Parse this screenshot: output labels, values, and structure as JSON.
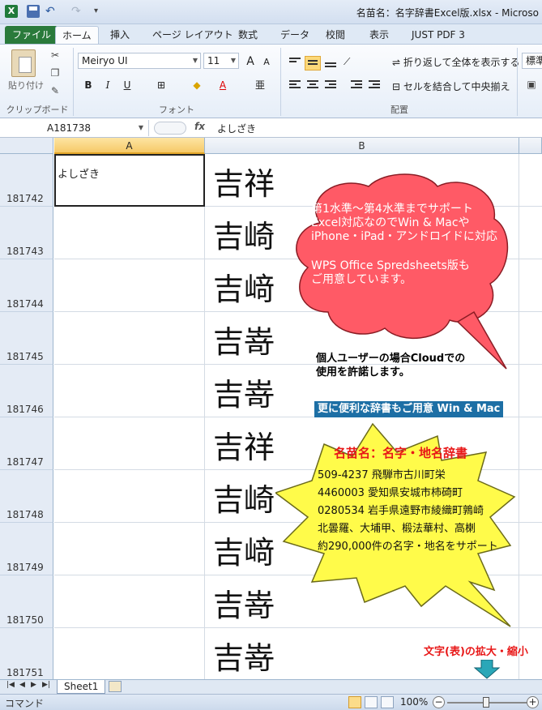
{
  "window": {
    "title": "名苗名：名字辞書Excel版.xlsx - Microso",
    "logo_letter": "X"
  },
  "tabs": [
    "ファイル",
    "ホーム",
    "挿入",
    "ページ レイアウト",
    "数式",
    "データ",
    "校閲",
    "表示",
    "JUST PDF 3"
  ],
  "ribbon": {
    "paste_label": "貼り付け",
    "clipboard_label": "クリップボード",
    "font_group_label": "フォント",
    "align_group_label": "配置",
    "font_name": "Meiryo UI",
    "font_size": "11",
    "grow_font": "A",
    "shrink_font": "A",
    "bold": "B",
    "italic": "I",
    "underline": "U",
    "wrap_text": "折り返して全体を表示する",
    "merge_center": "セルを結合して中央揃え",
    "number_format": "標準"
  },
  "formula_bar": {
    "cell_ref": "A181738",
    "fx": "fx",
    "content": "よしざき"
  },
  "columns": [
    "A",
    "B"
  ],
  "rows": [
    {
      "num": "181742",
      "reading": "よしざき",
      "name": "吉祥"
    },
    {
      "num": "181743",
      "reading": "",
      "name": "吉崎"
    },
    {
      "num": "181744",
      "reading": "",
      "name": "吉﨑"
    },
    {
      "num": "181745",
      "reading": "",
      "name": "吉嵜"
    },
    {
      "num": "181746",
      "reading": "",
      "name": "吉嵜"
    },
    {
      "num": "181747",
      "reading": "",
      "name": "吉祥"
    },
    {
      "num": "181748",
      "reading": "",
      "name": "吉崎"
    },
    {
      "num": "181749",
      "reading": "",
      "name": "吉﨑"
    },
    {
      "num": "181750",
      "reading": "",
      "name": "吉嵜"
    },
    {
      "num": "181751",
      "reading": "",
      "name": "吉嵜"
    }
  ],
  "callouts": {
    "cloud_lines": [
      "第1水準～第4水準までサポート",
      "Excel対応なのでWin & Macや",
      "iPhone・iPad・アンドロイドに対応",
      "",
      "WPS Office Spredsheets版も",
      "ご用意しています。"
    ],
    "license_lines": [
      "個人ユーザーの場合Cloudでの",
      "使用を許諾します。"
    ],
    "banner": "更に便利な辞書もご用意 Win & Mac",
    "star_title": "名苗名：名字・地名辞書",
    "star_lines": [
      "509-4237  飛騨市古川町栄",
      "4460003   愛知県安城市柿碕町",
      "0280534   岩手県遠野市綾織町鶉崎",
      "北曇羅、大埔甲、椴法華村、高楋",
      "約290,000件の名字・地名をサポート"
    ],
    "zoom_note": "文字(表)の拡大・縮小"
  },
  "sheets": [
    "Sheet1"
  ],
  "status": {
    "mode": "コマンド",
    "zoom": "100%"
  }
}
